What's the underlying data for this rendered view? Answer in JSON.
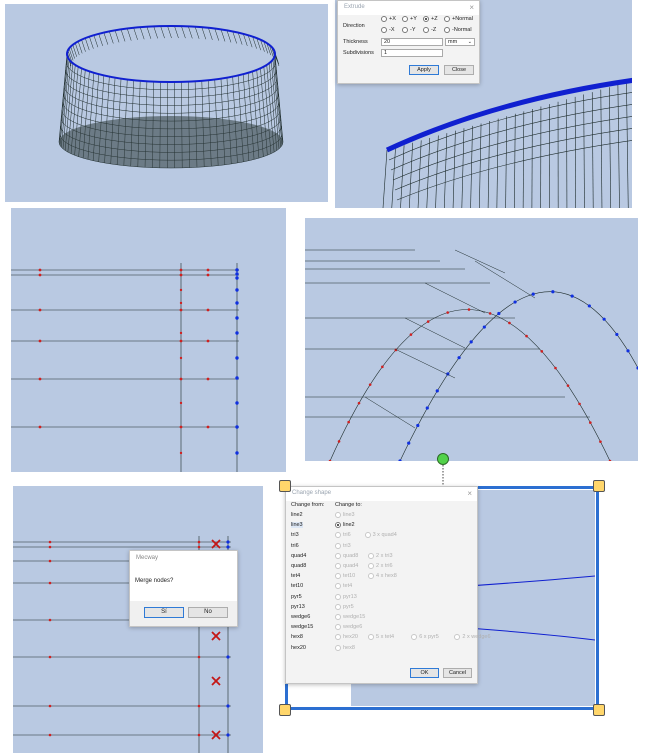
{
  "extrude_dialog": {
    "title": "Extrude",
    "direction_label": "Direction",
    "dir_row1": [
      "+X",
      "+Y",
      "+Z",
      "+Normal"
    ],
    "dir_row2": [
      "-X",
      "-Y",
      "-Z",
      "-Normal"
    ],
    "selected": "+Z",
    "thickness_label": "Thickness",
    "thickness_value": "20",
    "unit_value": "mm",
    "subdivisions_label": "Subdivisions",
    "subdivisions_value": "1",
    "apply_label": "Apply",
    "close_label": "Close"
  },
  "merge_dialog": {
    "title": "Mecway",
    "message": "Merge nodes?",
    "yes_label": "Sí",
    "no_label": "No"
  },
  "change_shape_dialog": {
    "title": "Change shape",
    "change_from_header": "Change from:",
    "change_to_header": "Change to:",
    "from_items": [
      "line2",
      "line3",
      "tri3",
      "tri6",
      "quad4",
      "quad8",
      "tet4",
      "tet10",
      "pyr5",
      "pyr13",
      "wedge6",
      "wedge15",
      "hex8",
      "hex20"
    ],
    "to_options": [
      [
        "line3"
      ],
      [
        "line2"
      ],
      [
        "tri6",
        "3 x quad4"
      ],
      [
        "tri3"
      ],
      [
        "quad8",
        "2 x tri3"
      ],
      [
        "quad4",
        "2 x tri6"
      ],
      [
        "tet10",
        "4 x hex8"
      ],
      [
        "tet4"
      ],
      [
        "pyr13"
      ],
      [
        "pyr5"
      ],
      [
        "wedge15"
      ],
      [
        "wedge6"
      ],
      [
        "hex20",
        "5 x tet4",
        "6 x pyr5",
        "2 x wedge6"
      ],
      [
        "hex8"
      ]
    ],
    "selected_from": "line3",
    "selected_to": "line2",
    "ok_label": "OK",
    "cancel_label": "Cancel"
  },
  "colors": {
    "viewport_bg": "#b9c9e2",
    "mesh_line": "#1c2a2a",
    "edge_blue": "#1020d0",
    "node_red": "#d02020",
    "node_blue": "#1030e0",
    "handle_yellow": "#ffd66b",
    "handle_green": "#52d24a",
    "selection_blue": "#2c6fd1"
  }
}
